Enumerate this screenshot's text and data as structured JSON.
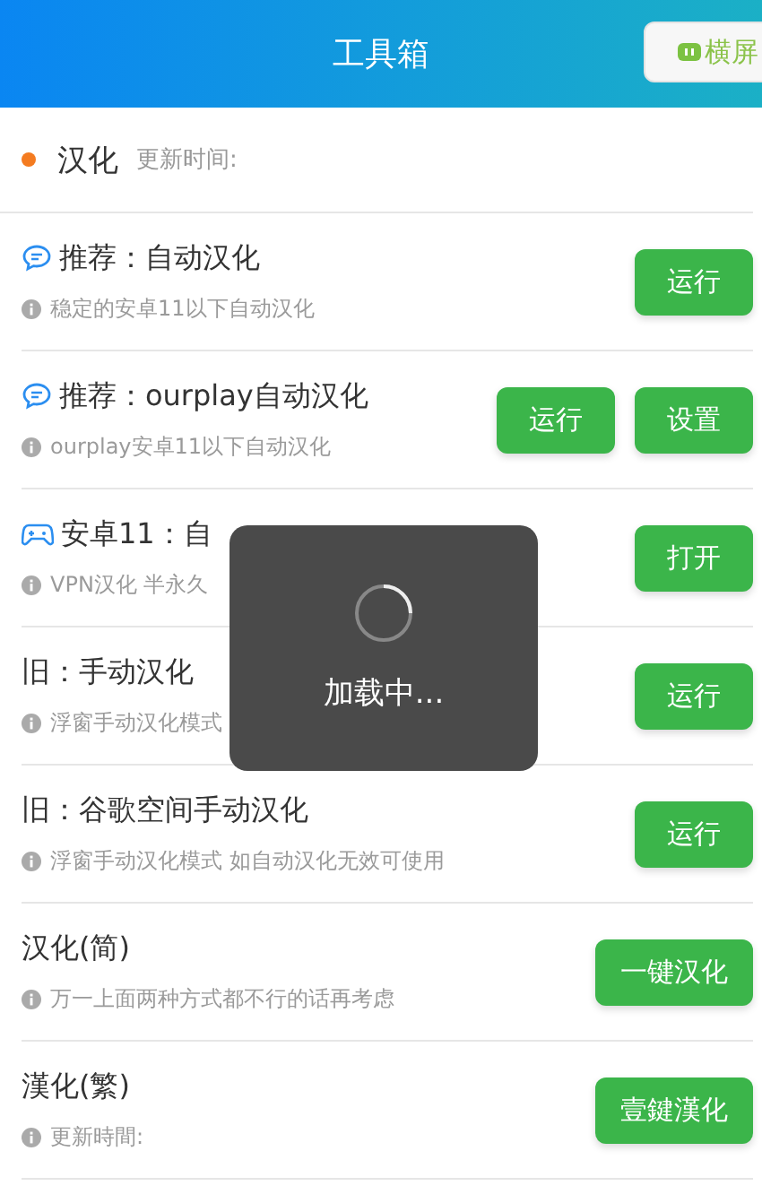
{
  "header": {
    "title": "工具箱",
    "landscape_button": "横屏"
  },
  "section": {
    "title": "汉化",
    "subtitle": "更新时间:",
    "color": "#f47b20"
  },
  "items": [
    {
      "kind": "chat",
      "title": "推荐：自动汉化",
      "desc": "稳定的安卓11以下自动汉化",
      "buttons": [
        "运行"
      ]
    },
    {
      "kind": "chat",
      "title": "推荐：ourplay自动汉化",
      "desc": "ourplay安卓11以下自动汉化",
      "buttons": [
        "运行",
        "设置"
      ]
    },
    {
      "kind": "gamepad",
      "title": "安卓11：自",
      "desc": "VPN汉化 半永久",
      "buttons": [
        "打开"
      ]
    },
    {
      "kind": "plain",
      "title": "旧：手动汉化",
      "desc": "浮窗手动汉化模式",
      "buttons": [
        "运行"
      ]
    },
    {
      "kind": "plain",
      "title": "旧：谷歌空间手动汉化",
      "desc": "浮窗手动汉化模式 如自动汉化无效可使用",
      "buttons": [
        "运行"
      ]
    },
    {
      "kind": "plain",
      "title": "汉化(简)",
      "desc": "万一上面两种方式都不行的话再考虑",
      "buttons": [
        "一键汉化"
      ]
    },
    {
      "kind": "plain",
      "title": "漢化(繁)",
      "desc": "更新時間:",
      "buttons": [
        "壹鍵漢化"
      ]
    }
  ],
  "loading": {
    "text": "加载中..."
  }
}
